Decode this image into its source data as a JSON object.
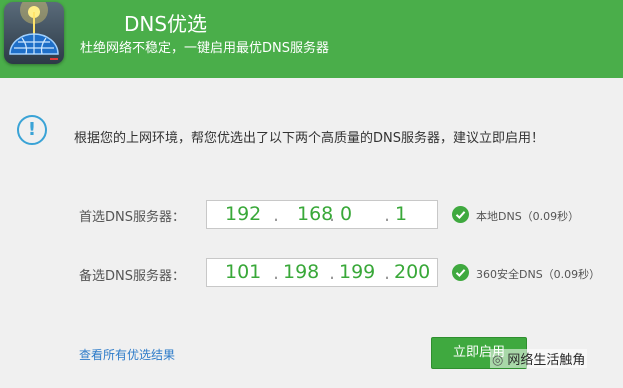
{
  "header": {
    "title": "DNS优选",
    "subtitle": "杜绝网络不稳定，一键启用最优DNS服务器",
    "bg_color": "#4aae4a",
    "icon": "globe-antenna-icon"
  },
  "info": {
    "icon": "exclamation-icon",
    "text": "根据您的上网环境，帮您优选出了以下两个高质量的DNS服务器，建议立即启用！"
  },
  "primary": {
    "label": "首选DNS服务器：",
    "ip": [
      "192",
      "168",
      "0",
      "1"
    ],
    "status": "本地DNS（0.09秒）"
  },
  "secondary": {
    "label": "备选DNS服务器：",
    "ip": [
      "101",
      "198",
      "199",
      "200"
    ],
    "status": "360安全DNS（0.09秒）"
  },
  "footer": {
    "link_label": "查看所有优选结果",
    "apply_label": "立即启用"
  },
  "watermark": {
    "text": "网络生活触角"
  },
  "colors": {
    "accent_green": "#3fa93f",
    "ip_text": "#39a839",
    "info_blue": "#3aa3d6",
    "link_blue": "#2d7bc9"
  }
}
